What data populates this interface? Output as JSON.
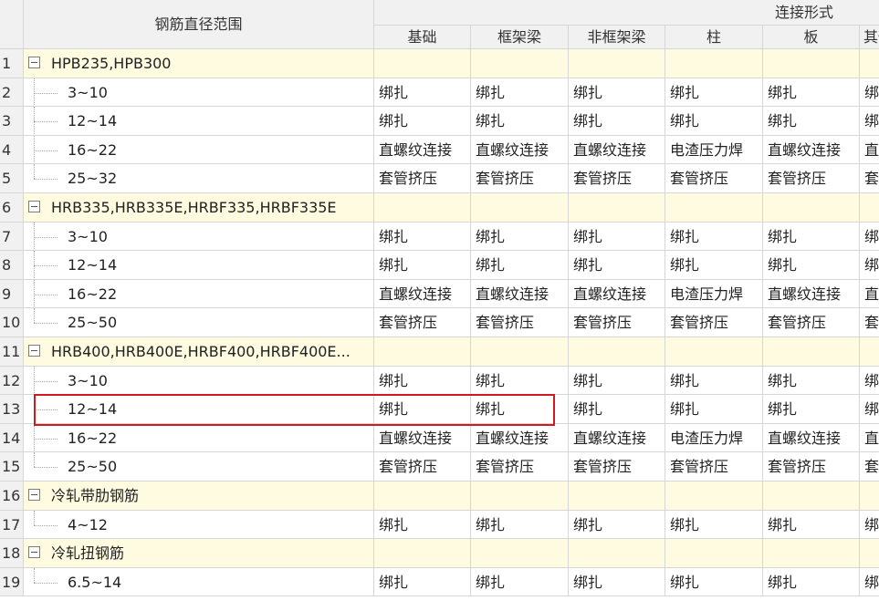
{
  "header": {
    "range_label": "钢筋直径范围",
    "group_label": "连接形式",
    "columns": [
      "基础",
      "框架梁",
      "非框架梁",
      "柱",
      "板",
      "其他"
    ]
  },
  "rows": [
    {
      "num": "1",
      "type": "group",
      "name": "HPB235,HPB300",
      "expanded": true
    },
    {
      "num": "2",
      "type": "item",
      "name": "3~10",
      "values": [
        "绑扎",
        "绑扎",
        "绑扎",
        "绑扎",
        "绑扎",
        "绑扎"
      ]
    },
    {
      "num": "3",
      "type": "item",
      "name": "12~14",
      "values": [
        "绑扎",
        "绑扎",
        "绑扎",
        "绑扎",
        "绑扎",
        "绑扎"
      ]
    },
    {
      "num": "4",
      "type": "item",
      "name": "16~22",
      "values": [
        "直螺纹连接",
        "直螺纹连接",
        "直螺纹连接",
        "电渣压力焊",
        "直螺纹连接",
        "直螺纹连接"
      ]
    },
    {
      "num": "5",
      "type": "item",
      "name": "25~32",
      "last": true,
      "values": [
        "套管挤压",
        "套管挤压",
        "套管挤压",
        "套管挤压",
        "套管挤压",
        "套管挤压"
      ]
    },
    {
      "num": "6",
      "type": "group",
      "name": "HRB335,HRB335E,HRBF335,HRBF335E",
      "expanded": true
    },
    {
      "num": "7",
      "type": "item",
      "name": "3~10",
      "values": [
        "绑扎",
        "绑扎",
        "绑扎",
        "绑扎",
        "绑扎",
        "绑扎"
      ]
    },
    {
      "num": "8",
      "type": "item",
      "name": "12~14",
      "values": [
        "绑扎",
        "绑扎",
        "绑扎",
        "绑扎",
        "绑扎",
        "绑扎"
      ]
    },
    {
      "num": "9",
      "type": "item",
      "name": "16~22",
      "values": [
        "直螺纹连接",
        "直螺纹连接",
        "直螺纹连接",
        "电渣压力焊",
        "直螺纹连接",
        "直螺纹连接"
      ]
    },
    {
      "num": "10",
      "type": "item",
      "name": "25~50",
      "last": true,
      "values": [
        "套管挤压",
        "套管挤压",
        "套管挤压",
        "套管挤压",
        "套管挤压",
        "套管挤压"
      ]
    },
    {
      "num": "11",
      "type": "group",
      "name": "HRB400,HRB400E,HRBF400,HRBF400E...",
      "expanded": true
    },
    {
      "num": "12",
      "type": "item",
      "name": "3~10",
      "values": [
        "绑扎",
        "绑扎",
        "绑扎",
        "绑扎",
        "绑扎",
        "绑扎"
      ]
    },
    {
      "num": "13",
      "type": "item",
      "name": "12~14",
      "highlighted": true,
      "values": [
        "绑扎",
        "绑扎",
        "绑扎",
        "绑扎",
        "绑扎",
        "绑扎"
      ]
    },
    {
      "num": "14",
      "type": "item",
      "name": "16~22",
      "values": [
        "直螺纹连接",
        "直螺纹连接",
        "直螺纹连接",
        "电渣压力焊",
        "直螺纹连接",
        "直螺纹连接"
      ]
    },
    {
      "num": "15",
      "type": "item",
      "name": "25~50",
      "last": true,
      "values": [
        "套管挤压",
        "套管挤压",
        "套管挤压",
        "套管挤压",
        "套管挤压",
        "套管挤压"
      ]
    },
    {
      "num": "16",
      "type": "group",
      "name": "冷轧带肋钢筋",
      "expanded": true
    },
    {
      "num": "17",
      "type": "item",
      "name": "4~12",
      "last": true,
      "values": [
        "绑扎",
        "绑扎",
        "绑扎",
        "绑扎",
        "绑扎",
        "绑扎"
      ]
    },
    {
      "num": "18",
      "type": "group",
      "name": "冷轧扭钢筋",
      "expanded": true
    },
    {
      "num": "19",
      "type": "item",
      "name": "6.5~14",
      "last": true,
      "values": [
        "绑扎",
        "绑扎",
        "绑扎",
        "绑扎",
        "绑扎",
        "绑扎"
      ]
    }
  ],
  "colors": {
    "group_bg": "#fffbe1",
    "header_bg": "#f1f1f1",
    "highlight": "#d11a20",
    "grid_line": "#d6d6d6"
  }
}
